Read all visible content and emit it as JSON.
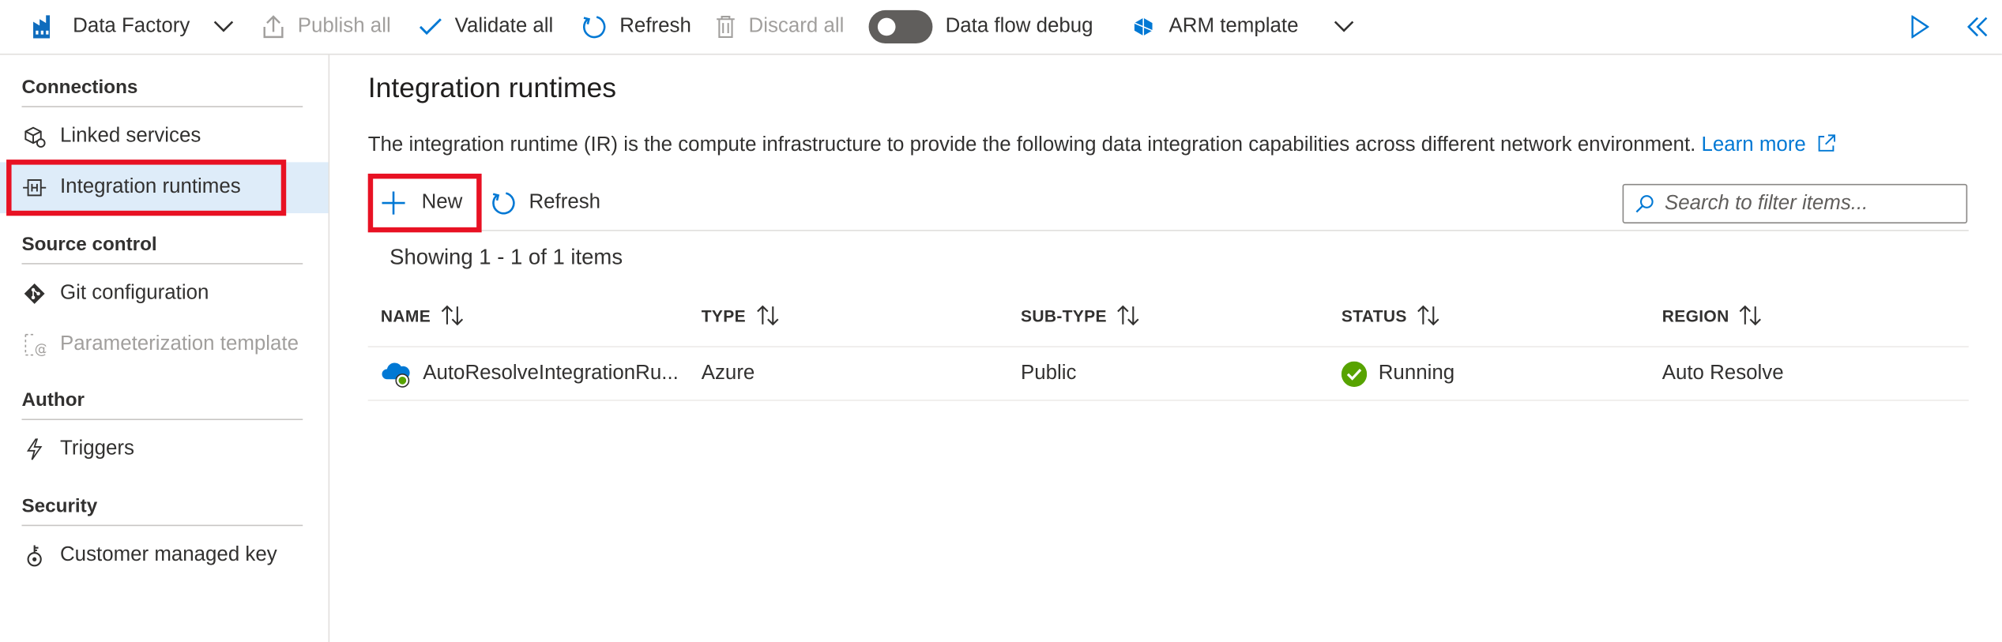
{
  "toolbar": {
    "factory_label": "Data Factory",
    "publish_label": "Publish all",
    "validate_label": "Validate all",
    "refresh_label": "Refresh",
    "discard_label": "Discard all",
    "debug_label": "Data flow debug",
    "arm_label": "ARM template"
  },
  "sidebar": {
    "sections": [
      {
        "title": "Connections"
      },
      {
        "title": "Source control"
      },
      {
        "title": "Author"
      },
      {
        "title": "Security"
      }
    ],
    "items": [
      {
        "label": "Linked services"
      },
      {
        "label": "Integration runtimes"
      },
      {
        "label": "Git configuration"
      },
      {
        "label": "Parameterization template"
      },
      {
        "label": "Triggers"
      },
      {
        "label": "Customer managed key"
      }
    ]
  },
  "main": {
    "title": "Integration runtimes",
    "description": "The integration runtime (IR) is the compute infrastructure to provide the following data integration capabilities across different network environment.",
    "learn_more": "Learn more",
    "new_label": "New",
    "refresh_label": "Refresh",
    "search_placeholder": "Search to filter items...",
    "showing": "Showing 1 - 1 of 1 items",
    "columns": [
      "NAME",
      "TYPE",
      "SUB-TYPE",
      "STATUS",
      "REGION"
    ],
    "rows": [
      {
        "name": "AutoResolveIntegrationRu...",
        "type": "Azure",
        "subtype": "Public",
        "status": "Running",
        "region": "Auto Resolve"
      }
    ]
  },
  "colors": {
    "accent": "#0078d4",
    "highlight_box": "#e81123",
    "selected_bg": "#deecf9",
    "status_running": "#57a300"
  }
}
